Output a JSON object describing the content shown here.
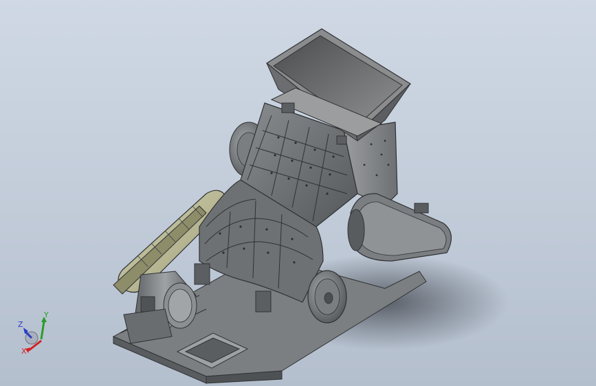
{
  "viewport": {
    "background_top": "#cfd8e4",
    "background_bottom": "#b4bfce"
  },
  "triad": {
    "x_label": "X",
    "y_label": "Y",
    "z_label": "Z",
    "x_color": "#d42020",
    "y_color": "#2a9d2a",
    "z_color": "#2a3cc8"
  },
  "model": {
    "body_color": "#6f7275",
    "belt_guard_color": "#b8b894",
    "hopper_color": "#7a7b7d"
  }
}
